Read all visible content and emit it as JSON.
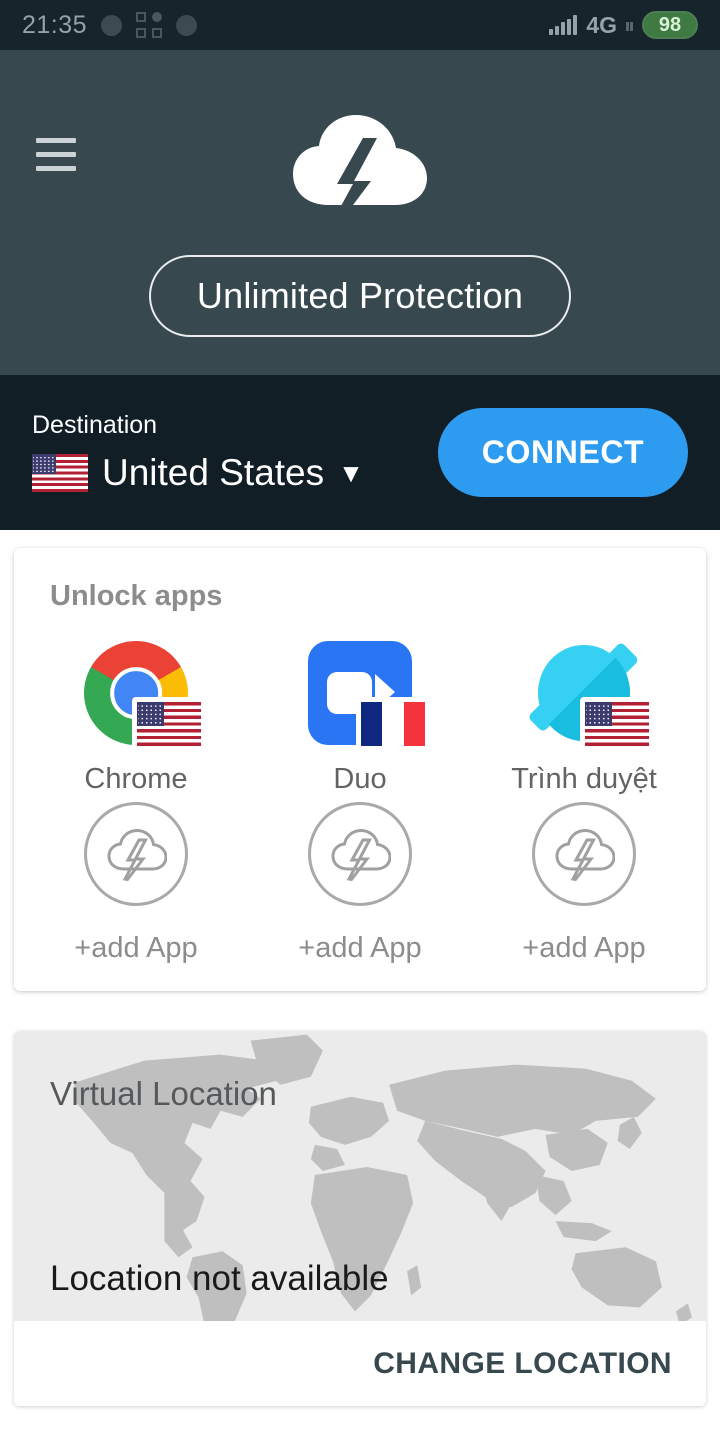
{
  "statusbar": {
    "time": "21:35",
    "network": "4G",
    "battery": "98",
    "icons": [
      "circle-icon",
      "apps-grid-icon",
      "circle-icon",
      "signal-bars-icon",
      "data-transfer-icon",
      "battery-icon"
    ]
  },
  "header": {
    "menu_icon": "hamburger-menu-icon",
    "logo_icon": "cloud-lightning-logo",
    "protection_label": "Unlimited Protection",
    "background_color": "#37484f"
  },
  "destination": {
    "label": "Destination",
    "country": "United States",
    "flag": "us",
    "caret": "▼",
    "connect_label": "CONNECT",
    "connect_color": "#2d9cf0",
    "background_color": "#111e26"
  },
  "unlock_apps": {
    "title": "Unlock apps",
    "apps": [
      {
        "name": "Chrome",
        "icon": "chrome-icon",
        "flag": "us"
      },
      {
        "name": "Duo",
        "icon": "duo-icon",
        "flag": "fr"
      },
      {
        "name": "Trình duyệt",
        "icon": "browser-icon",
        "flag": "us"
      }
    ],
    "add_slots": [
      {
        "label": "+add App",
        "icon": "cloud-lightning-icon"
      },
      {
        "label": "+add App",
        "icon": "cloud-lightning-icon"
      },
      {
        "label": "+add App",
        "icon": "cloud-lightning-icon"
      }
    ]
  },
  "virtual_location": {
    "title": "Virtual Location",
    "status": "Location not available",
    "change_label": "CHANGE LOCATION",
    "map_icon": "world-map",
    "map_background": "#ebebeb",
    "map_land_color": "#bfbfbf"
  }
}
